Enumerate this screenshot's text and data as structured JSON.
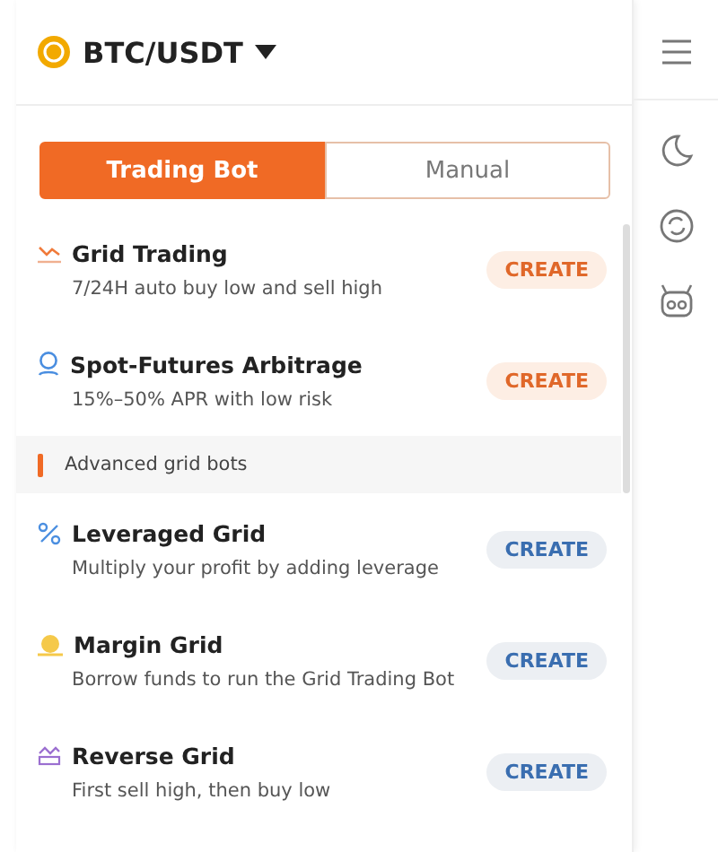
{
  "pair": {
    "label": "BTC/USDT"
  },
  "tabs": [
    {
      "label": "Trading Bot",
      "selected": true
    },
    {
      "label": "Manual",
      "selected": false
    }
  ],
  "featured_bots": [
    {
      "title": "Grid Trading",
      "subtitle": "7/24H auto buy low and sell high",
      "button": "CREATE"
    },
    {
      "title": "Spot-Futures Arbitrage",
      "subtitle": "15%–50% APR with low risk",
      "button": "CREATE"
    }
  ],
  "advanced_section": {
    "title": "Advanced grid bots",
    "bots": [
      {
        "title": "Leveraged Grid",
        "subtitle": "Multiply your profit by adding leverage",
        "button": "CREATE"
      },
      {
        "title": "Margin Grid",
        "subtitle": "Borrow funds to run the Grid Trading Bot",
        "button": "CREATE"
      },
      {
        "title": "Reverse Grid",
        "subtitle": "First sell high, then buy low",
        "button": "CREATE"
      }
    ]
  }
}
